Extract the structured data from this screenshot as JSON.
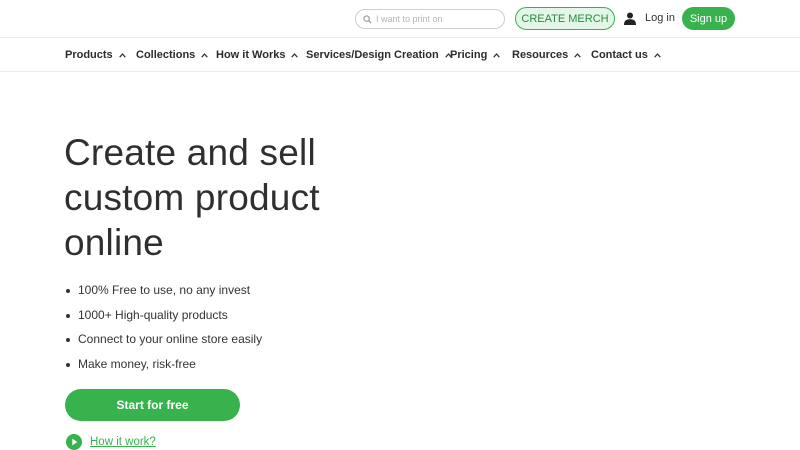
{
  "header": {
    "search": {
      "placeholder": "I want to print on",
      "value": ""
    },
    "create_merch_label": "CREATE MERCH",
    "login_label": "Log in",
    "signup_label": "Sign up"
  },
  "nav": {
    "items": [
      {
        "label": "Products"
      },
      {
        "label": "Collections"
      },
      {
        "label": "How it Works"
      },
      {
        "label": "Services/Design Creation"
      },
      {
        "label": "Pricing"
      },
      {
        "label": "Resources"
      },
      {
        "label": "Contact us"
      }
    ]
  },
  "hero": {
    "title_lines": [
      "Create and sell",
      "custom product",
      "online"
    ],
    "bullets": [
      "100% Free to use, no any invest",
      "1000+ High-quality products",
      "Connect to your online store easily",
      "Make money, risk-free"
    ],
    "cta_label": "Start for free",
    "how_link_label": "How it work?"
  },
  "colors": {
    "brand_green": "#37b24d",
    "create_bg": "#e3f7e8",
    "text": "#333333"
  },
  "icons": {
    "search": "search-icon",
    "user": "user-icon",
    "chevron": "chevron-up-icon",
    "play": "play-circle-icon"
  }
}
